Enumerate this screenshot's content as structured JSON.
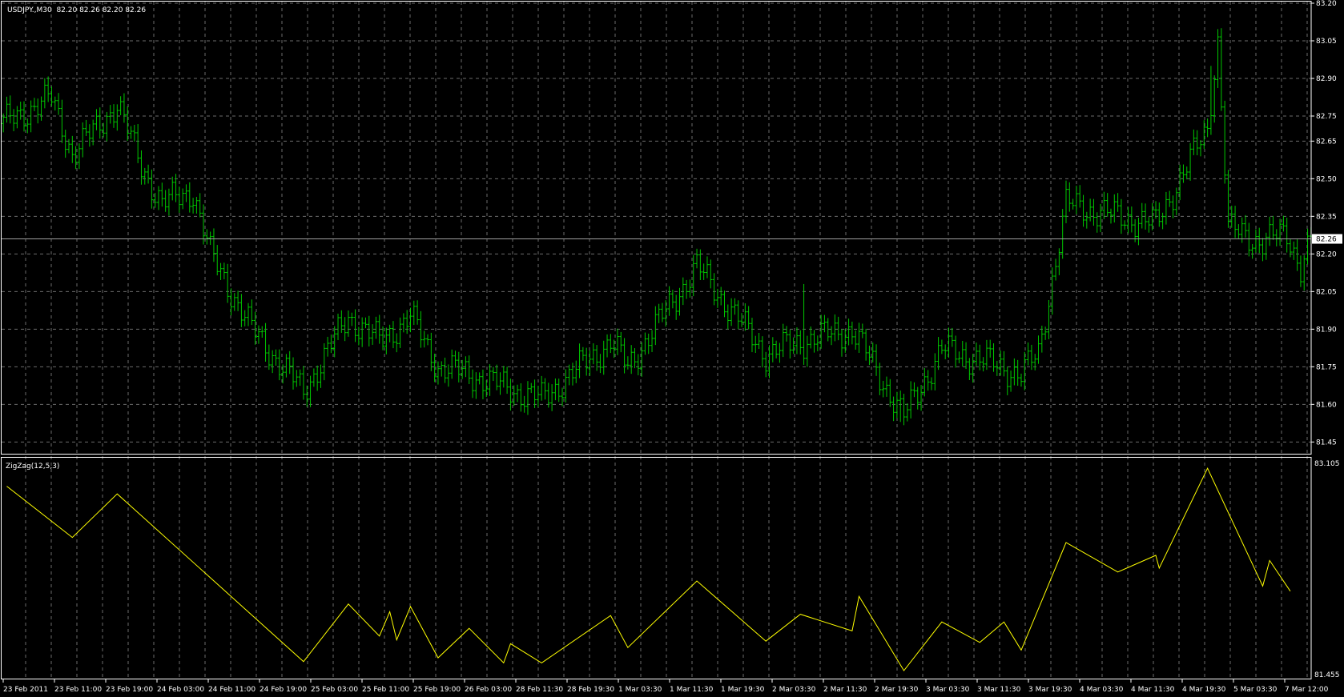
{
  "header": {
    "symbol_info": "USDJPY.,M30  82.20 82.26 82.20 82.26"
  },
  "indicator": {
    "label": "ZigZag(12,5,3)"
  },
  "colors": {
    "bull": "#00c800",
    "bear": "#00c800",
    "zigzag": "#ffff00",
    "grid": "#6b6b6b",
    "axis": "#ffffff",
    "price_line": "#a0a0a0"
  },
  "chart_data": [
    {
      "type": "ohlc",
      "title": "USDJPY.,M30",
      "ylim": [
        81.45,
        83.2
      ],
      "y_ticks": [
        "83.20",
        "83.05",
        "82.90",
        "82.75",
        "82.65",
        "82.50",
        "82.35",
        "82.20",
        "82.05",
        "81.90",
        "81.75",
        "81.60",
        "81.45"
      ],
      "current_price": "82.26",
      "bar_count": 380,
      "x_ticks": [
        "23 Feb 2011",
        "23 Feb 11:00",
        "23 Feb 19:00",
        "24 Feb 03:00",
        "24 Feb 11:00",
        "24 Feb 19:00",
        "25 Feb 03:00",
        "25 Feb 11:00",
        "25 Feb 19:00",
        "26 Feb 03:00",
        "28 Feb 11:30",
        "28 Feb 19:30",
        "1 Mar 03:30",
        "1 Mar 11:30",
        "1 Mar 19:30",
        "2 Mar 03:30",
        "2 Mar 11:30",
        "2 Mar 19:30",
        "3 Mar 03:30",
        "3 Mar 11:30",
        "3 Mar 19:30",
        "4 Mar 03:30",
        "4 Mar 11:30",
        "4 Mar 19:30",
        "5 Mar 03:30",
        "7 Mar 12:00"
      ],
      "price_path": [
        [
          0,
          82.72
        ],
        [
          8,
          82.78
        ],
        [
          14,
          82.82
        ],
        [
          20,
          82.6
        ],
        [
          27,
          82.7
        ],
        [
          33,
          82.8
        ],
        [
          40,
          82.55
        ],
        [
          46,
          82.4
        ],
        [
          55,
          82.45
        ],
        [
          60,
          82.2
        ],
        [
          72,
          81.9
        ],
        [
          87,
          81.65
        ],
        [
          100,
          81.95
        ],
        [
          109,
          81.85
        ],
        [
          118,
          81.95
        ],
        [
          126,
          81.75
        ],
        [
          135,
          81.72
        ],
        [
          147,
          81.66
        ],
        [
          156,
          81.62
        ],
        [
          176,
          81.85
        ],
        [
          181,
          81.75
        ],
        [
          201,
          82.15
        ],
        [
          221,
          81.8
        ],
        [
          231,
          81.85
        ],
        [
          246,
          81.9
        ],
        [
          261,
          81.55
        ],
        [
          272,
          81.82
        ],
        [
          283,
          81.78
        ],
        [
          295,
          81.72
        ],
        [
          300,
          81.8
        ],
        [
          308,
          82.4
        ],
        [
          323,
          82.35
        ],
        [
          334,
          82.32
        ],
        [
          349,
          82.7
        ],
        [
          352,
          83.05
        ],
        [
          355,
          82.3
        ],
        [
          365,
          82.25
        ],
        [
          372,
          82.28
        ],
        [
          376,
          82.15
        ],
        [
          379,
          82.26
        ]
      ],
      "spikes": [
        [
          350,
          82.95
        ],
        [
          352,
          83.04
        ],
        [
          232,
          82.08
        ],
        [
          260,
          81.53
        ]
      ]
    },
    {
      "type": "line",
      "title": "ZigZag(12,5,3)",
      "ylim": [
        81.455,
        83.105
      ],
      "y_ticks": [
        "83.105",
        "81.455"
      ],
      "points": [
        [
          1,
          82.92
        ],
        [
          20,
          82.52
        ],
        [
          33,
          82.86
        ],
        [
          87,
          81.55
        ],
        [
          100,
          82.0
        ],
        [
          109,
          81.75
        ],
        [
          112,
          81.94
        ],
        [
          114,
          81.72
        ],
        [
          118,
          81.98
        ],
        [
          126,
          81.58
        ],
        [
          135,
          81.81
        ],
        [
          145,
          81.54
        ],
        [
          147,
          81.69
        ],
        [
          156,
          81.54
        ],
        [
          176,
          81.91
        ],
        [
          181,
          81.66
        ],
        [
          201,
          82.18
        ],
        [
          221,
          81.71
        ],
        [
          231,
          81.92
        ],
        [
          246,
          81.79
        ],
        [
          248,
          82.06
        ],
        [
          261,
          81.48
        ],
        [
          272,
          81.86
        ],
        [
          283,
          81.7
        ],
        [
          290,
          81.86
        ],
        [
          295,
          81.64
        ],
        [
          308,
          82.48
        ],
        [
          323,
          82.25
        ],
        [
          334,
          82.38
        ],
        [
          335,
          82.28
        ],
        [
          349,
          83.06
        ],
        [
          365,
          82.14
        ],
        [
          367,
          82.34
        ],
        [
          373,
          82.1
        ]
      ]
    }
  ]
}
